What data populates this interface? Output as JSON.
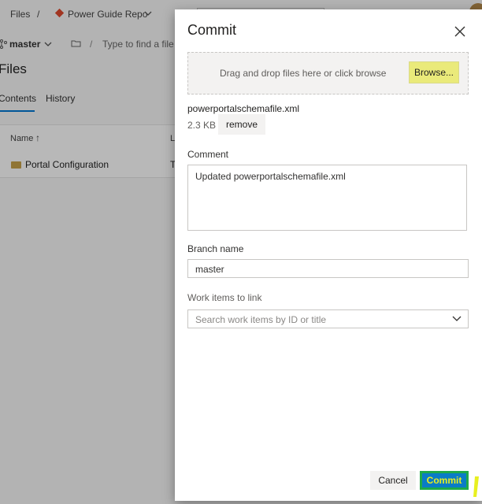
{
  "background": {
    "breadcrumb": {
      "files": "Files",
      "separator": "/",
      "repo": "Power Guide Repo"
    },
    "branch": "master",
    "path_placeholder": "Type to find a file",
    "page_title": "Files",
    "tabs": [
      {
        "label": "Contents"
      },
      {
        "label": "History"
      }
    ],
    "table": {
      "header_name": "Name",
      "sort_arrow": "↑",
      "header_col2": "L",
      "rows": [
        {
          "name": "Portal Configuration",
          "col2": "T"
        }
      ]
    }
  },
  "dialog": {
    "title": "Commit",
    "dropzone_text": "Drag and drop files here or click browse",
    "browse_label": "Browse...",
    "file": {
      "name": "powerportalschemafile.xml",
      "size": "2.3 KB",
      "remove_label": "remove"
    },
    "comment_label": "Comment",
    "comment_value": "Updated powerportalschemafile.xml",
    "branch_label": "Branch name",
    "branch_value": "master",
    "work_items_label": "Work items to link",
    "work_items_placeholder": "Search work items by ID or title",
    "cancel_label": "Cancel",
    "commit_label": "Commit"
  },
  "colors": {
    "accent": "#0078d4",
    "highlight": "#eaea7a",
    "commit_bg": "#0a7cc6",
    "commit_text": "#e8f020"
  }
}
